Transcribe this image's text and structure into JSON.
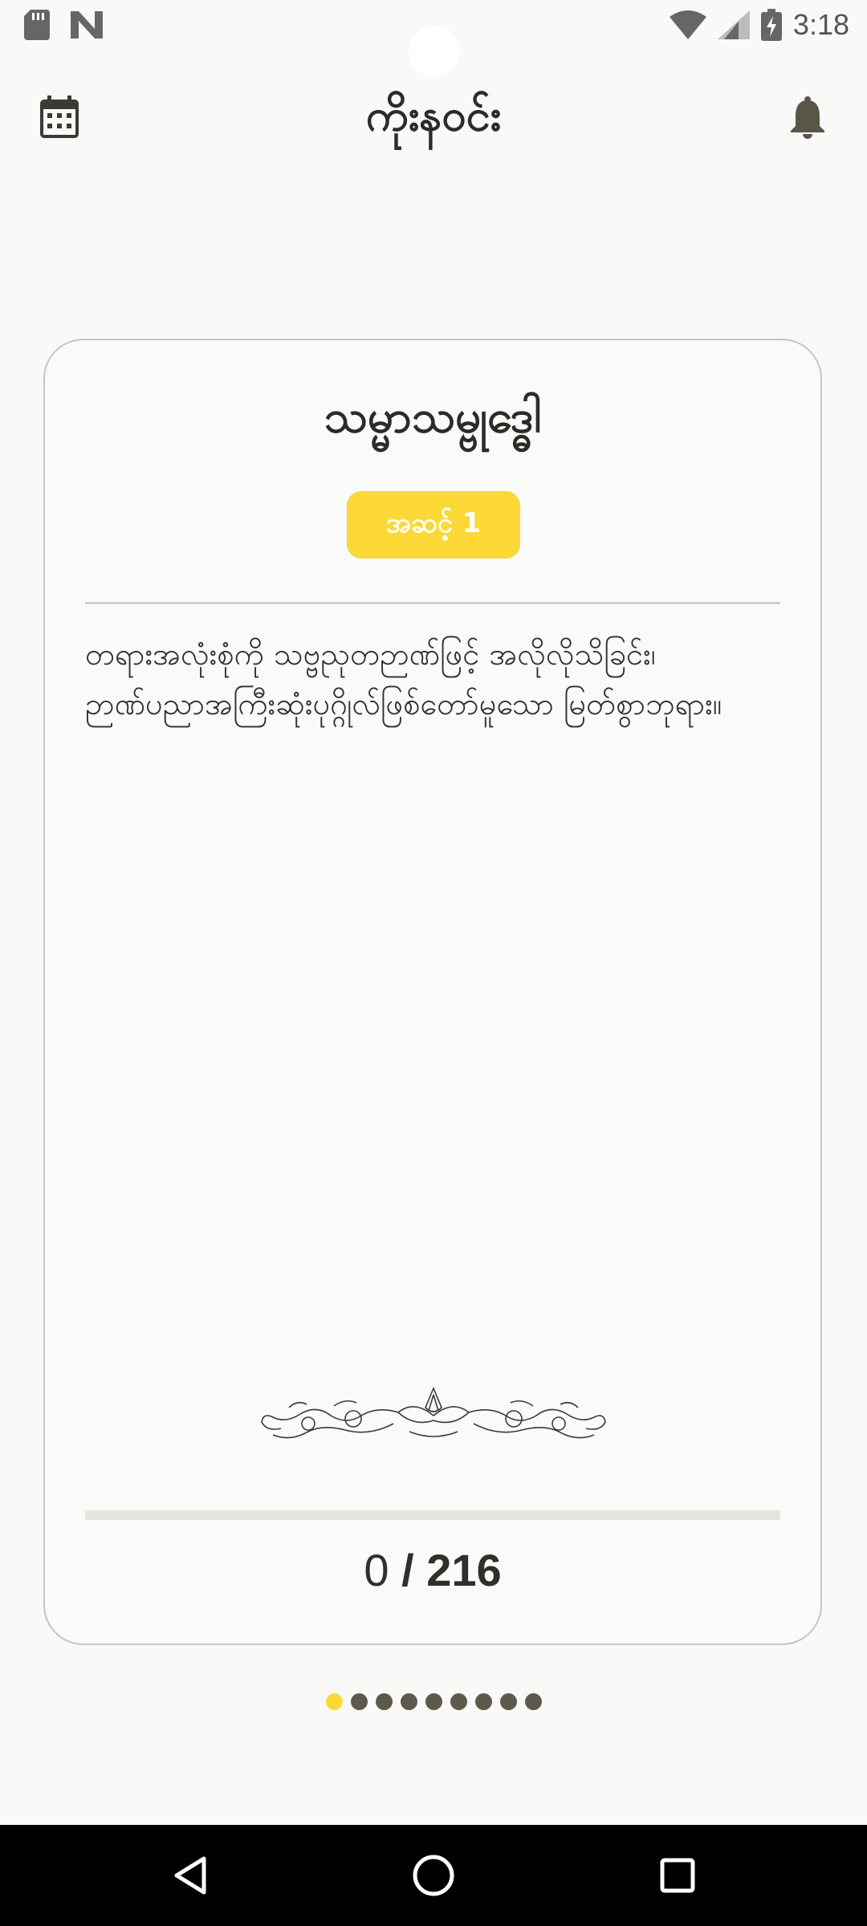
{
  "status_bar": {
    "time": "3:18",
    "icons": [
      "sd-card-icon",
      "n-logo-icon",
      "wifi-icon",
      "signal-icon",
      "battery-charging-icon"
    ]
  },
  "app_bar": {
    "title": "ကိုးနဝင်း",
    "left_icon": "calendar-icon",
    "right_icon": "bell-icon"
  },
  "card": {
    "title": "သမ္မာသမ္ဗုဒ္ဓေါ",
    "level_badge": "အဆင့် 1",
    "description": "တရားအလုံးစုံကို သဗ္ဗညုတဉာဏ်ဖြင့် အလိုလိုသိခြင်း၊ ဉာဏ်ပညာအကြီးဆုံးပုဂ္ဂိုလ်ဖြစ်တော်မူသော မြတ်စွာဘုရား။",
    "progress": {
      "current": "0",
      "separator": " / ",
      "total": "216",
      "fraction": 0
    }
  },
  "pager": {
    "count": 9,
    "active_index": 0
  },
  "nav_bar": {
    "buttons": [
      "back-icon",
      "home-icon",
      "recents-icon"
    ]
  },
  "colors": {
    "accent": "#fcd937",
    "dot_inactive": "#5d5a4c",
    "background": "#f9f9f7",
    "card_border": "#c5c5c7"
  }
}
